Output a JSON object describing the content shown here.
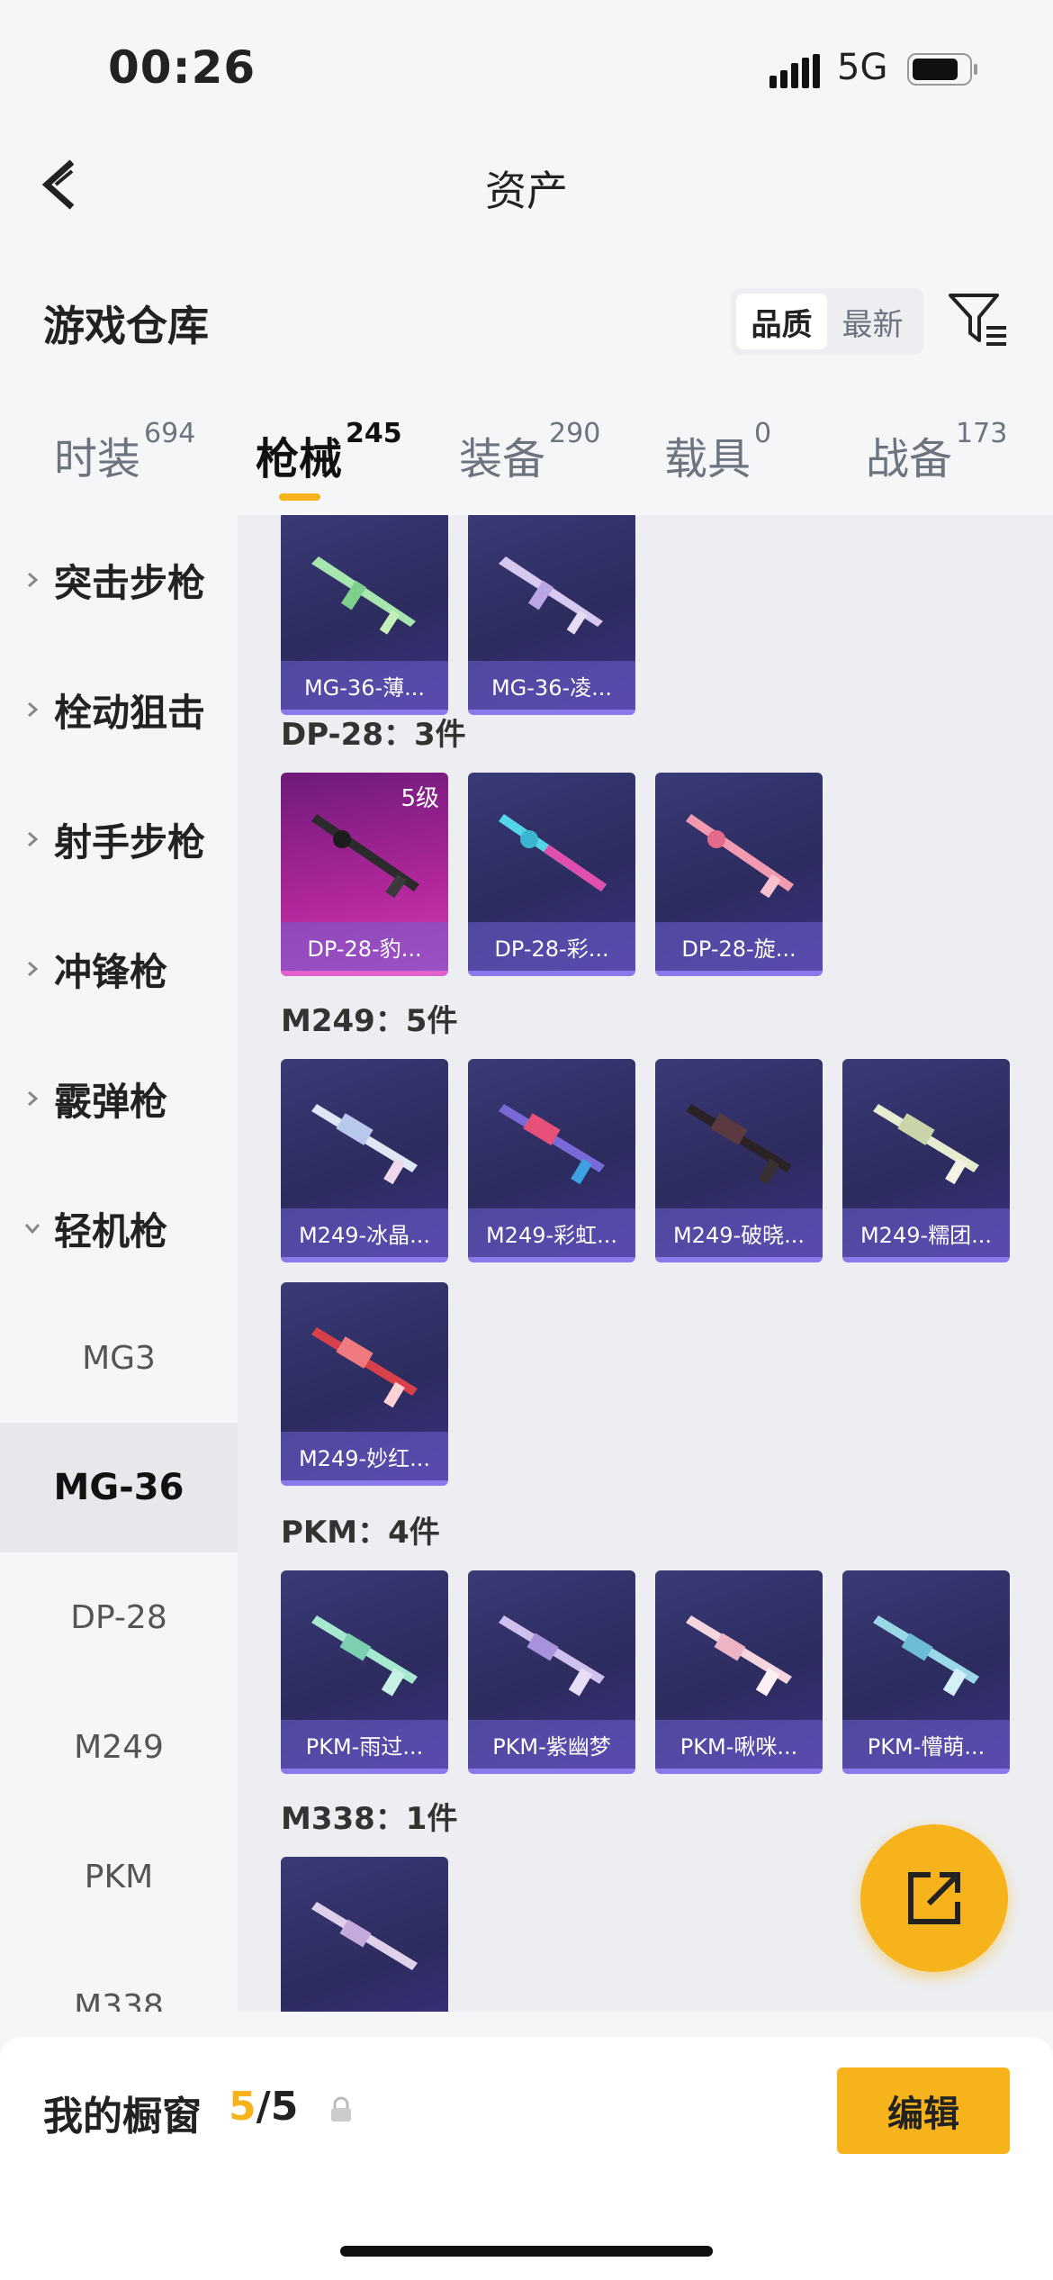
{
  "status_bar": {
    "time": "00:26",
    "network": "5G"
  },
  "nav": {
    "title": "资产"
  },
  "warehouse": {
    "title": "游戏仓库",
    "sort_options": [
      "品质",
      "最新"
    ]
  },
  "tabs": [
    {
      "label": "时装",
      "count": "694"
    },
    {
      "label": "枪械",
      "count": "245"
    },
    {
      "label": "装备",
      "count": "290"
    },
    {
      "label": "载具",
      "count": "0"
    },
    {
      "label": "战备",
      "count": "173"
    }
  ],
  "sidebar": {
    "categories": [
      "突击步枪",
      "栓动狙击",
      "射手步枪",
      "冲锋枪",
      "霰弹枪",
      "轻机枪"
    ],
    "subitems": [
      "MG3",
      "MG-36",
      "DP-28",
      "M249",
      "PKM",
      "M338"
    ]
  },
  "content": {
    "mg36_cards": [
      {
        "name": "MG-36-薄..."
      },
      {
        "name": "MG-36-凌..."
      }
    ],
    "dp28": {
      "title": "DP-28：3件",
      "cards": [
        {
          "name": "DP-28-豹...",
          "level": "5级"
        },
        {
          "name": "DP-28-彩..."
        },
        {
          "name": "DP-28-旋..."
        }
      ]
    },
    "m249": {
      "title": "M249：5件",
      "cards": [
        {
          "name": "M249-冰晶..."
        },
        {
          "name": "M249-彩虹..."
        },
        {
          "name": "M249-破晓..."
        },
        {
          "name": "M249-糯团..."
        },
        {
          "name": "M249-妙红..."
        }
      ]
    },
    "pkm": {
      "title": "PKM：4件",
      "cards": [
        {
          "name": "PKM-雨过..."
        },
        {
          "name": "PKM-紫幽梦"
        },
        {
          "name": "PKM-啾咪..."
        },
        {
          "name": "PKM-懵萌..."
        }
      ]
    },
    "m338": {
      "title": "M338：1件"
    }
  },
  "bottom": {
    "label": "我的橱窗",
    "count_current": "5",
    "count_total": "/5",
    "edit_label": "编辑"
  },
  "colors": {
    "accent": "#f7b31b",
    "card_bg": "#2c2c5e",
    "card_strip": "#8a79e8"
  }
}
